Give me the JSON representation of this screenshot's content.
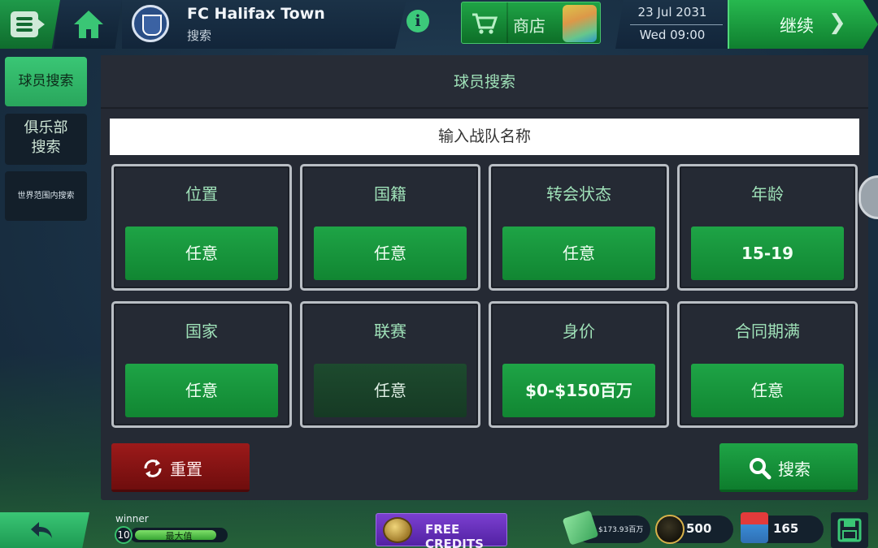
{
  "header": {
    "club_name": "FC Halifax Town",
    "subtitle": "搜索",
    "shop_label": "商店",
    "date": "23 Jul 2031",
    "time": "Wed 09:00",
    "continue_label": "继续"
  },
  "sidebar": {
    "items": [
      {
        "label": "球员搜索",
        "active": true
      },
      {
        "label": "俱乐部\n搜索",
        "active": false
      },
      {
        "label": "世界范围内搜索",
        "active": false
      }
    ]
  },
  "panel": {
    "title": "球员搜索",
    "team_input_placeholder": "输入战队名称",
    "filters": [
      {
        "label": "位置",
        "value": "任意"
      },
      {
        "label": "国籍",
        "value": "任意"
      },
      {
        "label": "转会状态",
        "value": "任意"
      },
      {
        "label": "年龄",
        "value": "15-19"
      },
      {
        "label": "国家",
        "value": "任意"
      },
      {
        "label": "联赛",
        "value": "任意"
      },
      {
        "label": "身价",
        "value": "$0-$150百万"
      },
      {
        "label": "合同期满",
        "value": "任意"
      }
    ],
    "reset_label": "重置",
    "search_label": "搜索"
  },
  "footer": {
    "user_name": "winner",
    "level": "10",
    "xp_label": "最大值",
    "xp_fraction": 0.93,
    "free_credits_label": "FREE CREDITS",
    "money": "$173.93百万",
    "coins": "500",
    "tokens": "165"
  },
  "colors": {
    "accent_green": "#1ea446",
    "title_green": "#9fe1b8",
    "reset_red": "#9c1a1a",
    "credits_purple": "#7b3fd0"
  },
  "icons": [
    "menu-icon",
    "home-icon",
    "info-icon",
    "cart-icon",
    "chevron-right-icon",
    "refresh-icon",
    "search-icon",
    "back-arrow-icon",
    "save-icon",
    "coin-icon",
    "cash-icon",
    "token-icon"
  ]
}
